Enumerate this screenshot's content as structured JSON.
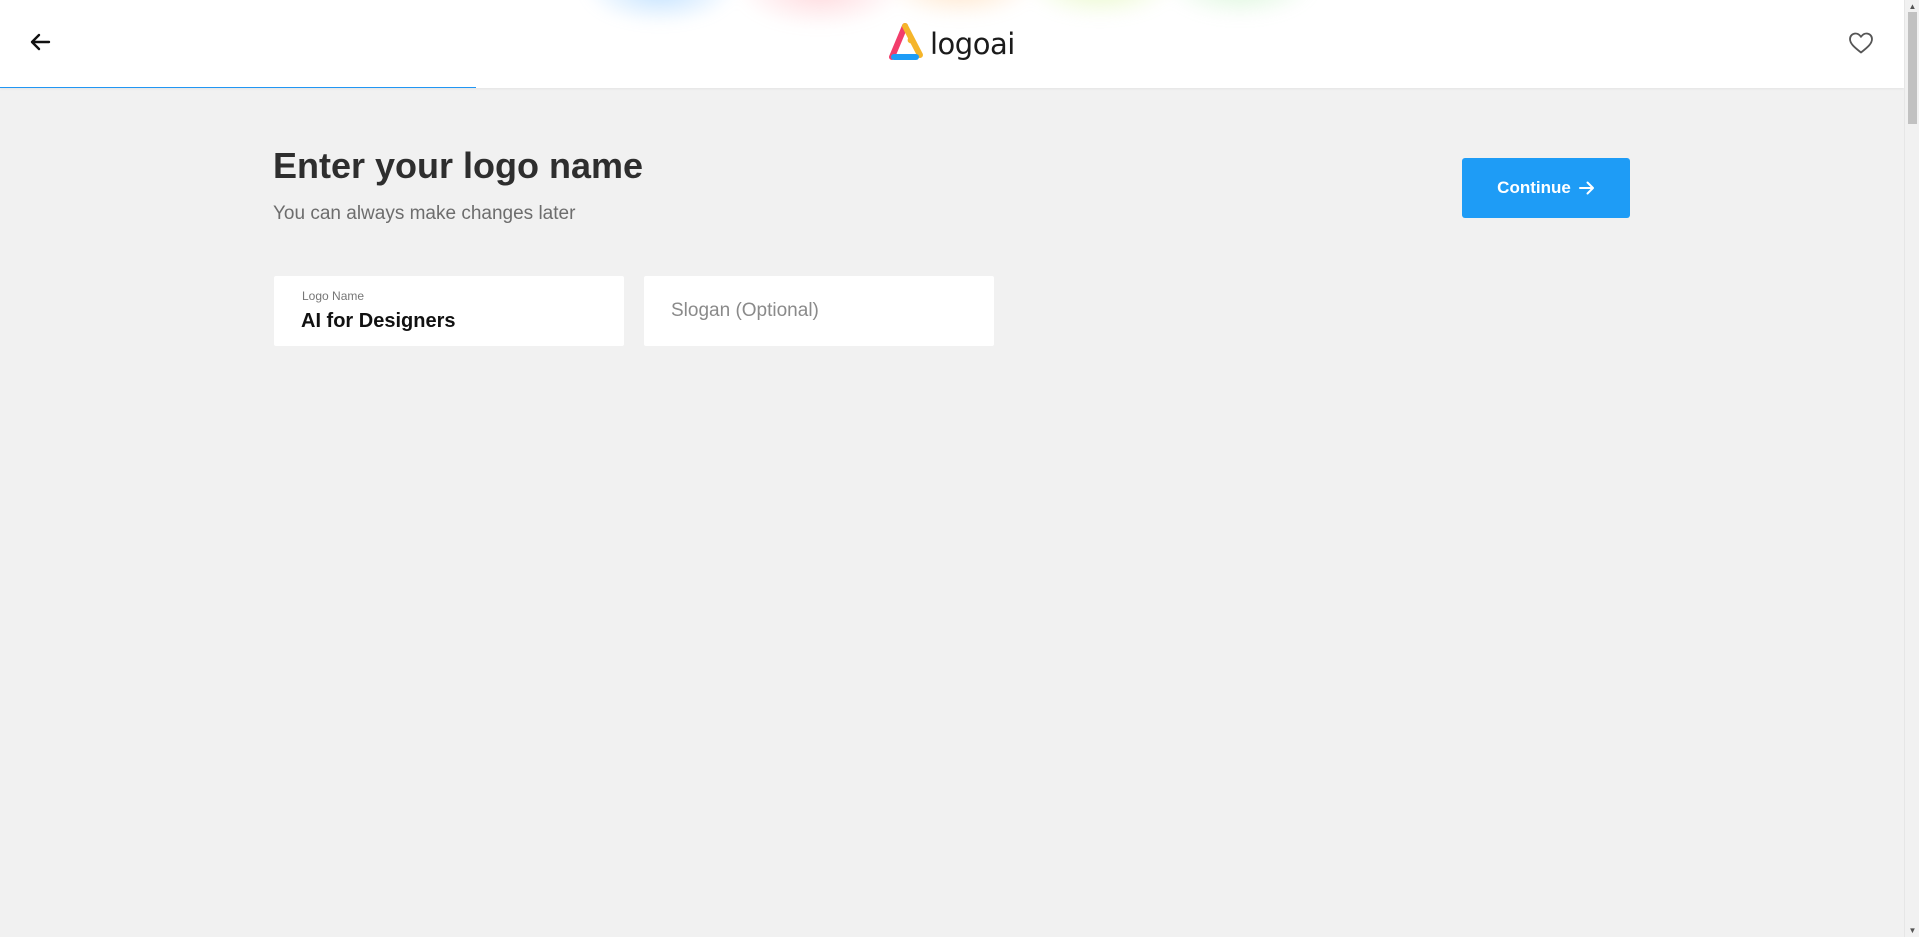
{
  "header": {
    "brand": "logoai",
    "back_icon": "arrow-left-icon",
    "favorite_icon": "heart-outline-icon",
    "progress_fraction": 0.25,
    "accent_color": "#2196f3"
  },
  "main": {
    "title": "Enter your logo name",
    "subtitle": "You can always make changes later",
    "continue_label": "Continue",
    "continue_icon": "arrow-right-icon",
    "button_color": "#1e9cf6"
  },
  "form": {
    "logo_name": {
      "label": "Logo Name",
      "value": "AI for Designers"
    },
    "slogan": {
      "placeholder": "Slogan (Optional)",
      "value": ""
    }
  }
}
